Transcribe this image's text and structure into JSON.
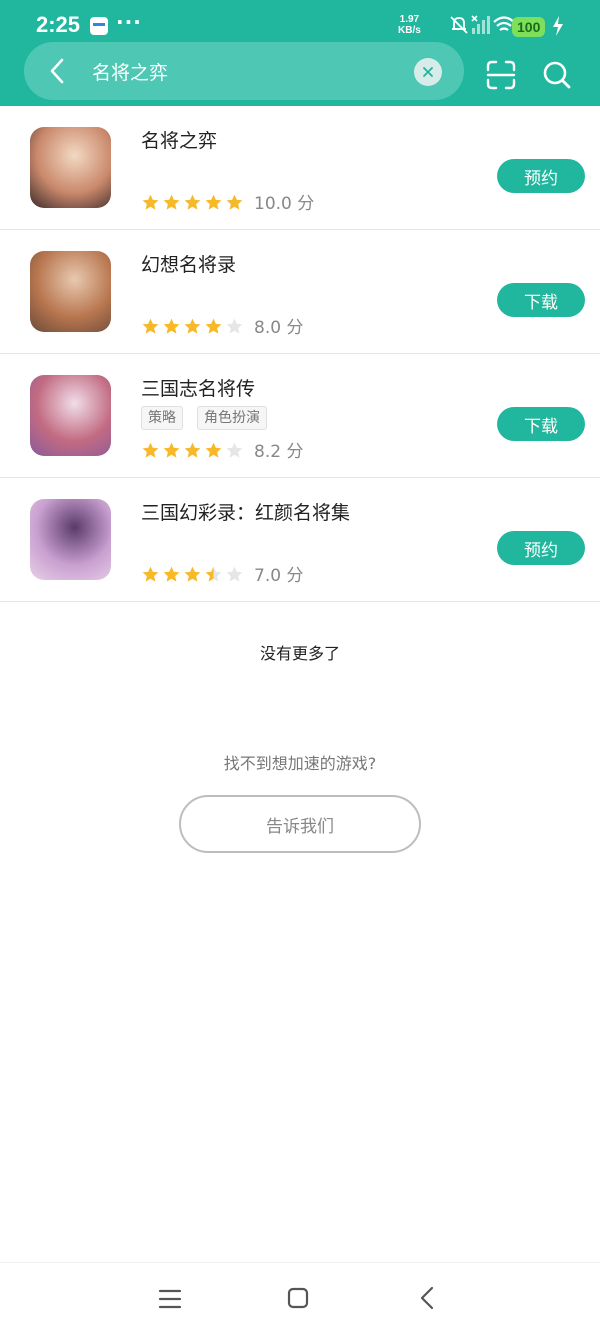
{
  "status_bar": {
    "time": "2:25",
    "more": "···",
    "speed_value": "1.97",
    "speed_unit": "KB/s",
    "battery": "100"
  },
  "search": {
    "query": "名将之弈"
  },
  "results": [
    {
      "title": "名将之弈",
      "tags": [],
      "rating": 5,
      "score": "10.0 分",
      "action": "预约",
      "icon": "game-icon-mingjiangzhiyi"
    },
    {
      "title": "幻想名将录",
      "tags": [],
      "rating": 4,
      "score": "8.0 分",
      "action": "下载",
      "icon": "game-icon-huanxiangmingjianglu"
    },
    {
      "title": "三国志名将传",
      "tags": [
        "策略",
        "角色扮演"
      ],
      "rating": 4,
      "score": "8.2 分",
      "action": "下载",
      "icon": "game-icon-sanguozhimingjiangzhuan"
    },
    {
      "title": "三国幻彩录：红颜名将集",
      "tags": [],
      "rating": 3.5,
      "score": "7.0 分",
      "action": "预约",
      "icon": "game-icon-sanguohuancailu"
    }
  ],
  "footer": {
    "no_more": "没有更多了",
    "cant_find": "找不到想加速的游戏?",
    "tell_us": "告诉我们"
  },
  "colors": {
    "primary": "#20b79e",
    "star": "#f7b928",
    "star_empty": "#e6e6e6"
  }
}
